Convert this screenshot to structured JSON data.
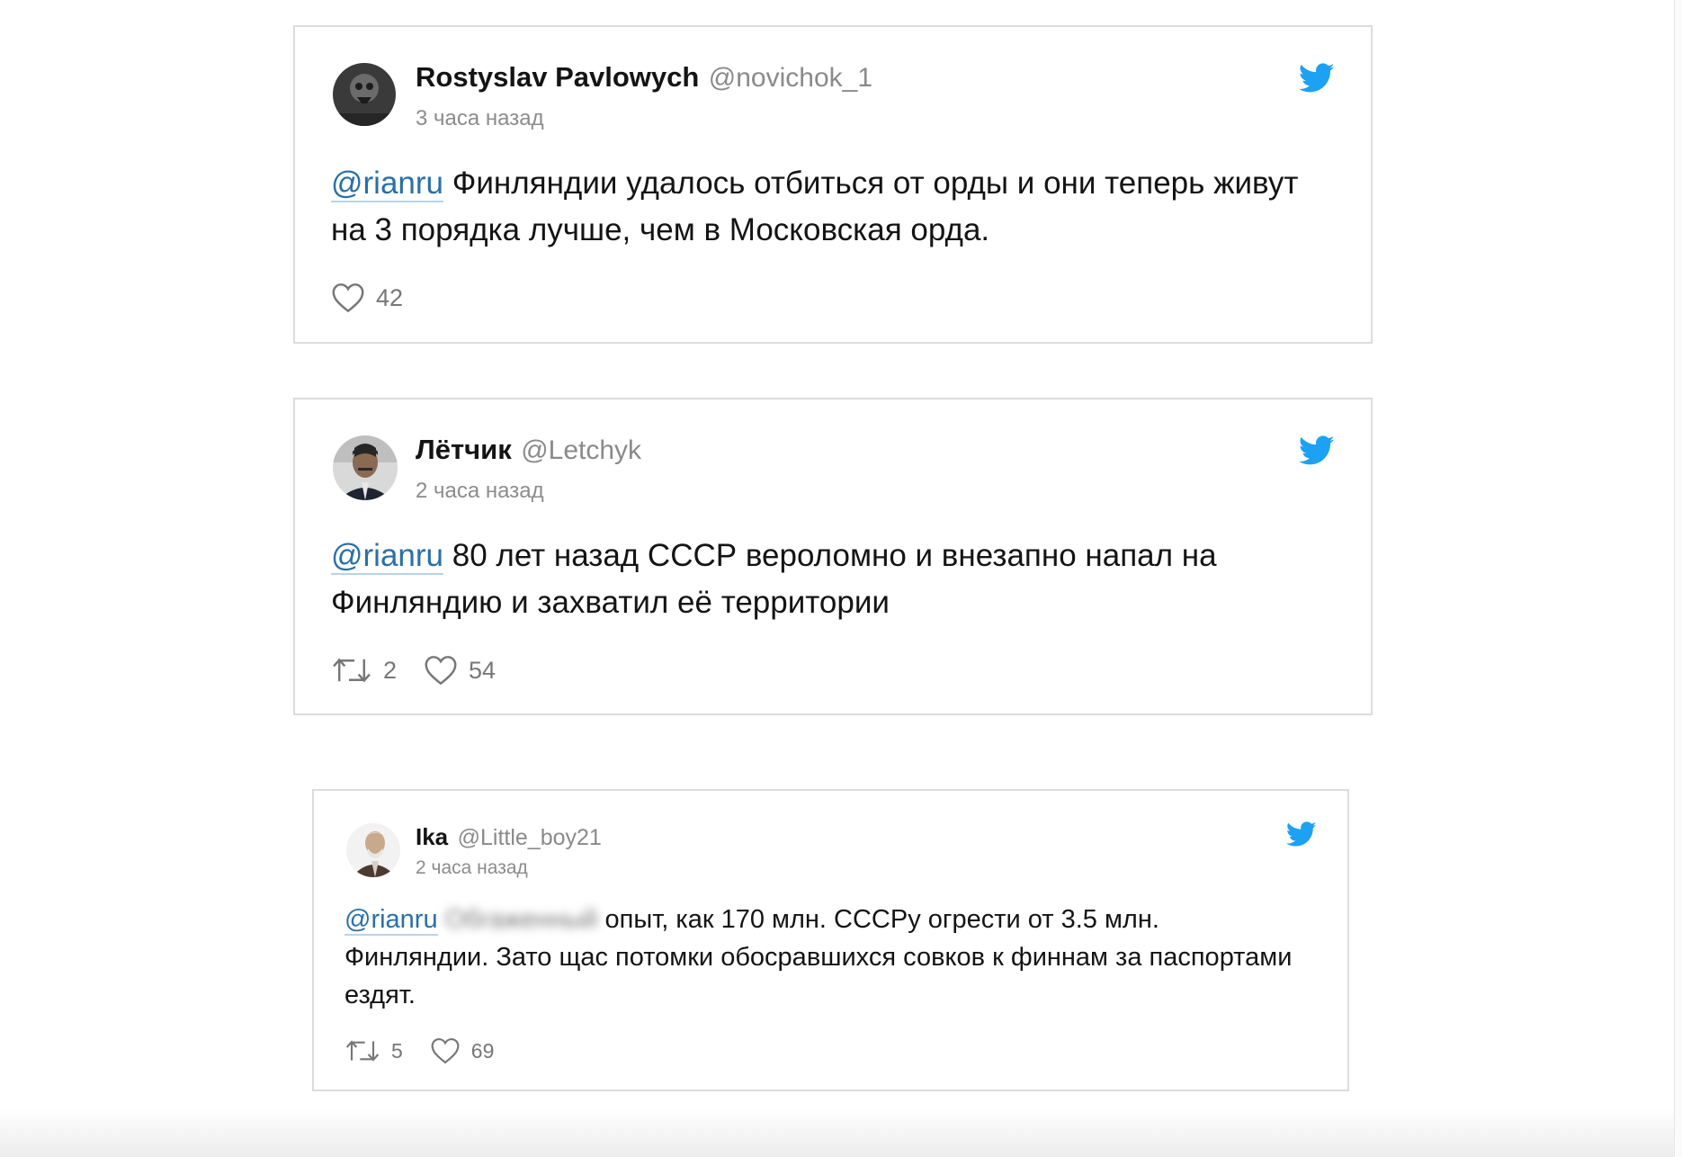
{
  "colors": {
    "twitter_blue": "#1da1f2",
    "mention_blue": "#2a6fa8",
    "muted_gray": "#8a8a8a",
    "card_border": "#dcdcdc"
  },
  "tweets": [
    {
      "author_name": "Rostyslav Pavlowych",
      "handle": "@novichok_1",
      "timestamp": "3 часа назад",
      "mention": "@rianru",
      "text": " Финляндии удалось отбиться от орды и они теперь живут на 3 порядка лучше, чем в Московская орда.",
      "likes": "42",
      "icon": "twitter-bird-icon"
    },
    {
      "author_name": "Лётчик",
      "handle": "@Letchyk",
      "timestamp": "2 часа назад",
      "mention": "@rianru",
      "text": " 80 лет назад СССР вероломно и внезапно напал на Финляндию и захватил её территории",
      "retweets": "2",
      "likes": "54",
      "icon": "twitter-bird-icon"
    },
    {
      "author_name": "Ika",
      "handle": "@Little_boy21",
      "timestamp": "2 часа назад",
      "mention": "@rianru",
      "blurred_word": "Обгаженный",
      "text": " опыт, как 170 млн. СССРу огрести от 3.5 млн. Финляндии. Зато щас потомки обосравшихся совков к финнам за паспортами ездят.",
      "retweets": "5",
      "likes": "69",
      "icon": "twitter-bird-icon"
    }
  ]
}
